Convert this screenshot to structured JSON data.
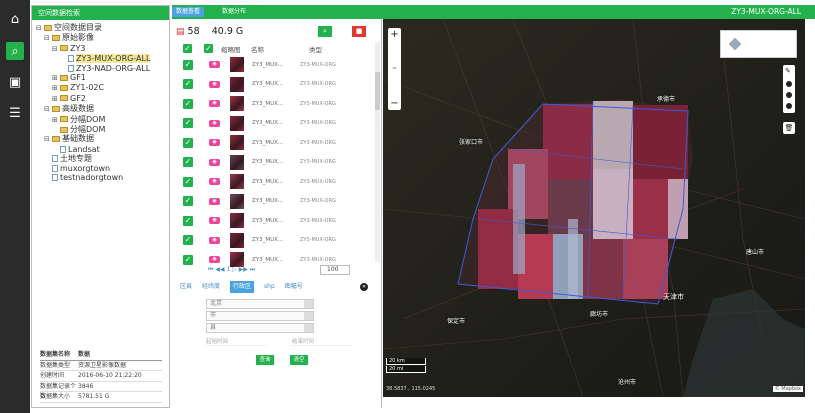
{
  "icon_bar": {
    "items": [
      {
        "name": "home-icon",
        "glyph": "⌂"
      },
      {
        "name": "search-icon",
        "glyph": "⌕"
      },
      {
        "name": "document-search-icon",
        "glyph": "▣"
      },
      {
        "name": "list-icon",
        "glyph": "☰"
      }
    ]
  },
  "tree_panel": {
    "title": "空间数据检索",
    "nodes": [
      {
        "label": "空间数据目录",
        "level": 0,
        "toggle": "⊟",
        "icon": "folder"
      },
      {
        "label": "原始影像",
        "level": 1,
        "toggle": "⊟",
        "icon": "folder"
      },
      {
        "label": "ZY3",
        "level": 2,
        "toggle": "⊟",
        "icon": "folder"
      },
      {
        "label": "ZY3-MUX-ORG-ALL",
        "level": 3,
        "toggle": "",
        "icon": "doc",
        "selected": true
      },
      {
        "label": "ZY3-NAD-ORG-ALL",
        "level": 3,
        "toggle": "",
        "icon": "doc"
      },
      {
        "label": "GF1",
        "level": 2,
        "toggle": "⊞",
        "icon": "folder"
      },
      {
        "label": "ZY1-02C",
        "level": 2,
        "toggle": "⊞",
        "icon": "folder"
      },
      {
        "label": "GF2",
        "level": 2,
        "toggle": "⊞",
        "icon": "folder"
      },
      {
        "label": "高级数据",
        "level": 1,
        "toggle": "⊟",
        "icon": "folder"
      },
      {
        "label": "分幅DOM",
        "level": 2,
        "toggle": "⊞",
        "icon": "folder"
      },
      {
        "label": "分幅DOM",
        "level": 2,
        "toggle": "",
        "icon": "folder"
      },
      {
        "label": "基础数据",
        "level": 1,
        "toggle": "⊟",
        "icon": "folder"
      },
      {
        "label": "Landsat",
        "level": 2,
        "toggle": "",
        "icon": "doc"
      },
      {
        "label": "土地专题",
        "level": 1,
        "toggle": "",
        "icon": "doc"
      },
      {
        "label": "muxorgtown",
        "level": 1,
        "toggle": "",
        "icon": "doc"
      },
      {
        "label": "testnadorgtown",
        "level": 1,
        "toggle": "",
        "icon": "doc"
      }
    ],
    "info_table": {
      "headers": [
        "数据集名称",
        "数据"
      ],
      "rows": [
        [
          "数据集类型",
          "资源卫星影像数据"
        ],
        [
          "创建时间",
          "2016-06-10 21:22:20"
        ],
        [
          "数据集记录个数",
          "3846"
        ],
        [
          "数据集大小",
          "5781.51 G"
        ]
      ]
    }
  },
  "main_header": {
    "tabs": [
      "数据查看",
      "数据分布"
    ],
    "title": "ZY3-MUX-ORG-ALL"
  },
  "results": {
    "count": "58",
    "size": "40.9 G",
    "columns": [
      "缩略图",
      "名称",
      "类型"
    ],
    "rows": [
      {
        "name": "ZY3_MUX...",
        "type": "ZY3-MUX-ORG",
        "thumb": "#9b2a3a"
      },
      {
        "name": "ZY3_MUX...",
        "type": "ZY3-MUX-ORG",
        "thumb": "#7b2233"
      },
      {
        "name": "ZY3_MUX...",
        "type": "ZY3-MUX-ORG",
        "thumb": "#a33448"
      },
      {
        "name": "ZY3_MUX...",
        "type": "ZY3-MUX-ORG",
        "thumb": "#8a2a3c"
      },
      {
        "name": "ZY3_MUX...",
        "type": "ZY3-MUX-ORG",
        "thumb": "#962c40"
      },
      {
        "name": "ZY3_MUX...",
        "type": "ZY3-MUX-ORG",
        "thumb": "#5a4a50"
      },
      {
        "name": "ZY3_MUX...",
        "type": "ZY3-MUX-ORG",
        "thumb": "#a23a4c"
      },
      {
        "name": "ZY3_MUX...",
        "type": "ZY3-MUX-ORG",
        "thumb": "#6a5058"
      },
      {
        "name": "ZY3_MUX...",
        "type": "ZY3-MUX-ORG",
        "thumb": "#8e2e42"
      },
      {
        "name": "ZY3_MUX...",
        "type": "ZY3-MUX-ORG",
        "thumb": "#7a2838"
      },
      {
        "name": "ZY3_MUX...",
        "type": "ZY3-MUX-ORG",
        "thumb": "#a03446"
      }
    ],
    "pager": "⏮ ◀◀ 1 ▷ ▶▶ ⏭",
    "page_size": "100"
  },
  "filter": {
    "tabs": [
      "区县",
      "经纬度",
      "行政区",
      "shp",
      "图幅号"
    ],
    "active_tab": "行政区",
    "selects": [
      "北京",
      "市",
      "县"
    ],
    "date_start": "起始时间",
    "date_end": "结束时间",
    "query_label": "查询",
    "clear_label": "清空"
  },
  "map": {
    "zoom_in": "+",
    "zoom_out": "−",
    "labels": [
      "承德市",
      "张家口市",
      "唐山市",
      "天津市",
      "保定市",
      "廊坊市",
      "沧州市"
    ],
    "scale_top": "20 km",
    "scale_bottom": "20 mi",
    "coordinates": "38.5837 , 115.0245",
    "attribution": "© Mapbox"
  },
  "colors": {
    "accent_green": "#22b14c",
    "tab_blue": "#4aa3e0",
    "checkbox_pink": "#e8489a",
    "footprint_blue": "#3b5bdb"
  }
}
